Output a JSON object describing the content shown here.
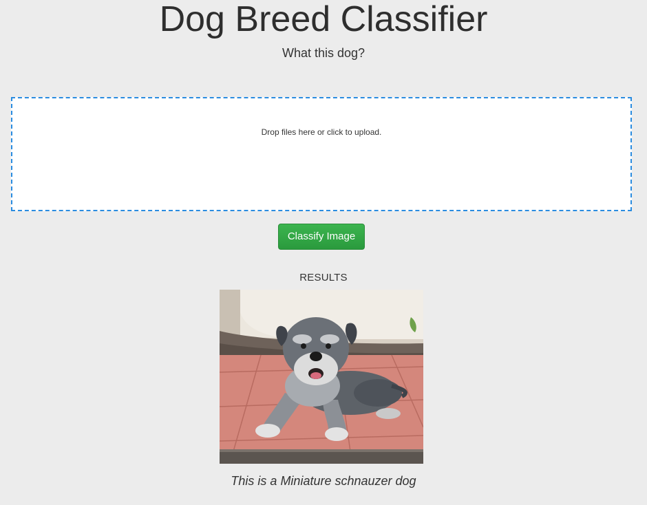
{
  "header": {
    "title": "Dog Breed Classifier",
    "subtitle": "What this dog?"
  },
  "upload": {
    "message": "Drop files here or click to upload.",
    "border_color": "#2a8ce0"
  },
  "actions": {
    "classify_label": "Classify Image",
    "classify_color": "#33a846"
  },
  "results": {
    "heading": "RESULTS",
    "image_subject": "miniature schnauzer dog lying on tiled floor",
    "caption": "This is a Miniature schnauzer dog"
  }
}
